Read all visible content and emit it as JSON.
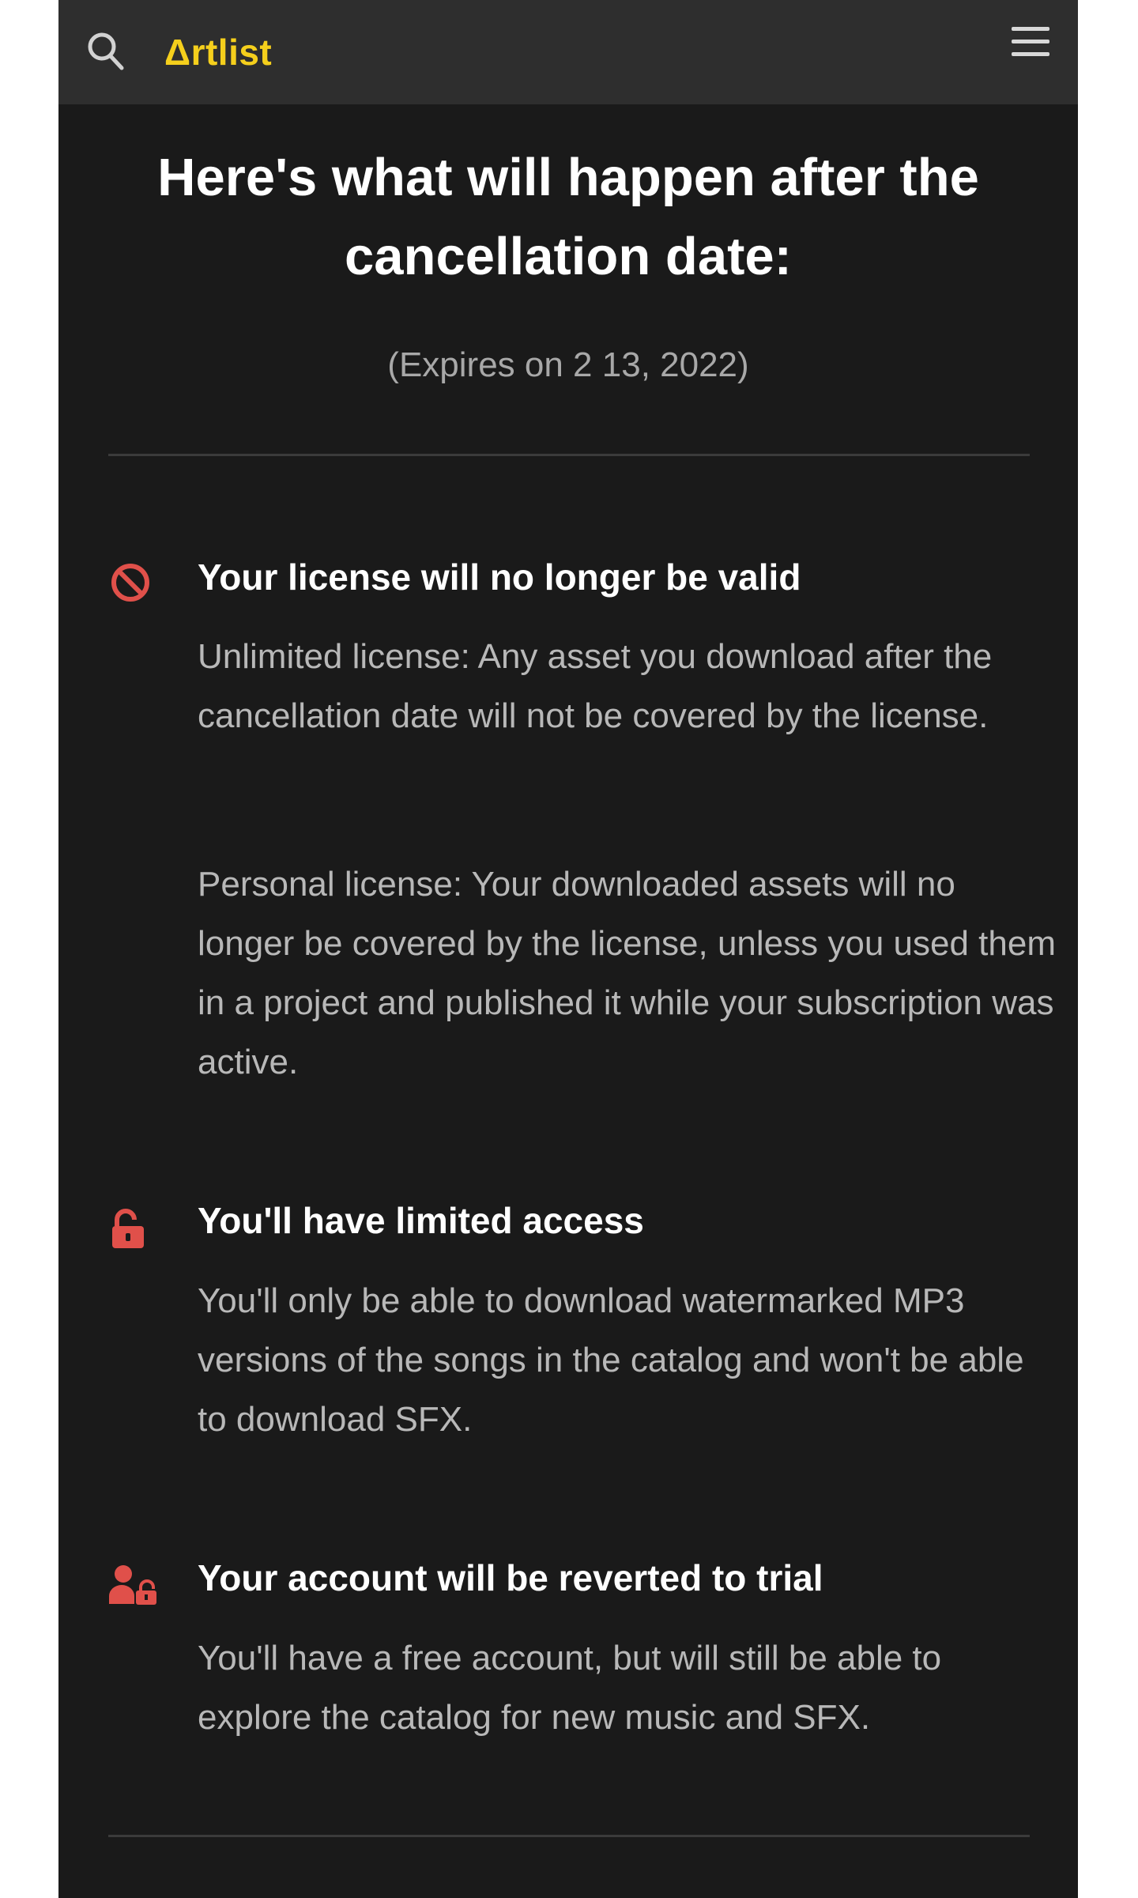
{
  "header": {
    "logo_text": "Δrtlist",
    "search_icon": "search-icon",
    "menu_icon": "hamburger-menu-icon",
    "accent_color": "#f5cf1c"
  },
  "main": {
    "title": "Here's what will happen after the cancellation date:",
    "expires": "(Expires on 2 13, 2022)",
    "sections": [
      {
        "icon": "prohibited-icon",
        "title": "Your license will no longer be valid",
        "paragraphs": [
          "Unlimited license: Any asset you download after the cancellation date will not be covered by the license.",
          "Personal license: Your downloaded assets will no longer be covered by the license, unless you used them in a project and published it while your subscription was active."
        ]
      },
      {
        "icon": "unlocked-padlock-icon",
        "title": "You'll have limited access",
        "paragraphs": [
          "You'll only be able to download watermarked MP3 versions of the songs in the catalog and won't be able to download SFX."
        ]
      },
      {
        "icon": "user-lock-icon",
        "title": "Your account will be reverted to trial",
        "paragraphs": [
          "You'll have a free account, but will still be able to explore the catalog for new music and SFX."
        ]
      }
    ],
    "icon_color": "#e0504a"
  }
}
